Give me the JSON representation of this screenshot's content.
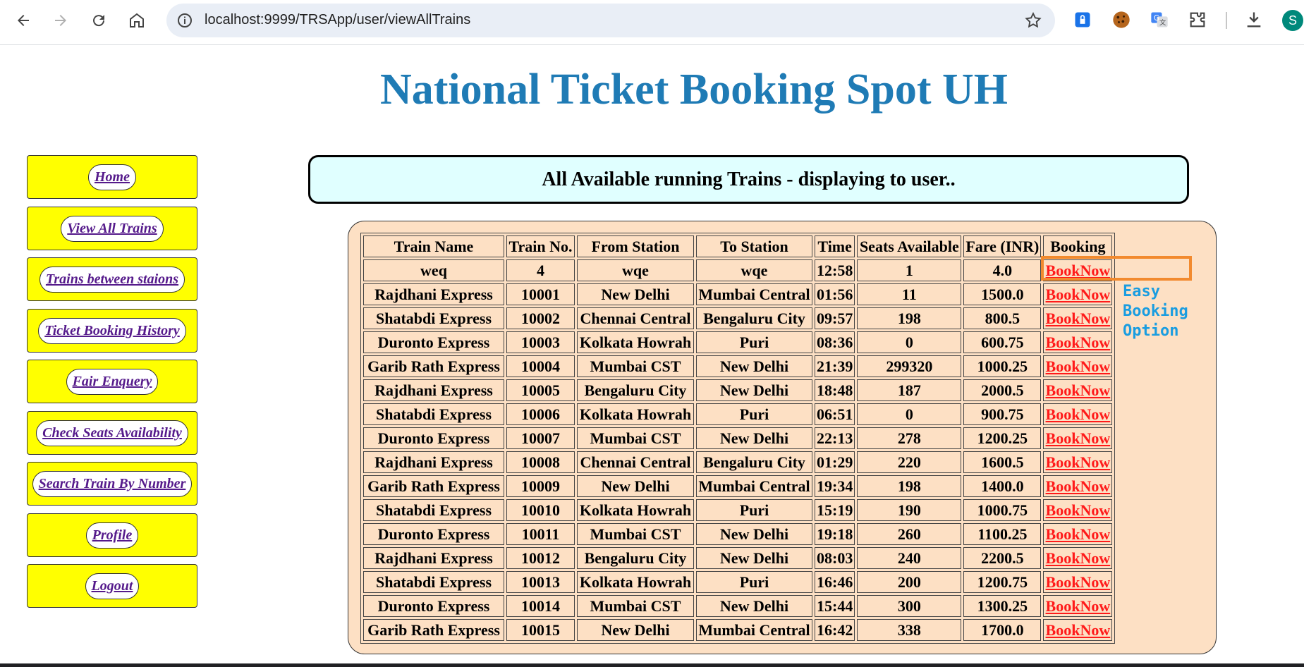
{
  "browser": {
    "url": "localhost:9999/TRSApp/user/viewAllTrains",
    "profile_initial": "S",
    "icons": [
      "back-arrow-icon",
      "forward-arrow-icon",
      "reload-icon",
      "home-icon",
      "site-info-icon",
      "bookmark-star-icon",
      "password-manager-icon",
      "cookie-icon",
      "translate-icon",
      "extensions-puzzle-icon",
      "download-icon"
    ]
  },
  "page": {
    "title": "National Ticket Booking Spot UH",
    "banner": "All Available running Trains - displaying to user.."
  },
  "sidebar": {
    "items": [
      {
        "label": "Home"
      },
      {
        "label": "View All Trains"
      },
      {
        "label": "Trains between staions"
      },
      {
        "label": "Ticket Booking History"
      },
      {
        "label": "Fair Enquery"
      },
      {
        "label": "Check Seats Availability"
      },
      {
        "label": "Search Train By Number"
      },
      {
        "label": "Profile"
      },
      {
        "label": "Logout"
      }
    ]
  },
  "table": {
    "headers": [
      "Train Name",
      "Train No.",
      "From Station",
      "To Station",
      "Time",
      "Seats Available",
      "Fare (INR)",
      "Booking"
    ],
    "rows": [
      {
        "name": "weq",
        "number": "4",
        "from": "wqe",
        "to": "wqe",
        "time": "12:58",
        "seats": "1",
        "fare": "4.0",
        "booking": "BookNow"
      },
      {
        "name": "Rajdhani Express",
        "number": "10001",
        "from": "New Delhi",
        "to": "Mumbai Central",
        "time": "01:56",
        "seats": "11",
        "fare": "1500.0",
        "booking": "BookNow"
      },
      {
        "name": "Shatabdi Express",
        "number": "10002",
        "from": "Chennai Central",
        "to": "Bengaluru City",
        "time": "09:57",
        "seats": "198",
        "fare": "800.5",
        "booking": "BookNow"
      },
      {
        "name": "Duronto Express",
        "number": "10003",
        "from": "Kolkata Howrah",
        "to": "Puri",
        "time": "08:36",
        "seats": "0",
        "fare": "600.75",
        "booking": "BookNow"
      },
      {
        "name": "Garib Rath Express",
        "number": "10004",
        "from": "Mumbai CST",
        "to": "New Delhi",
        "time": "21:39",
        "seats": "299320",
        "fare": "1000.25",
        "booking": "BookNow"
      },
      {
        "name": "Rajdhani Express",
        "number": "10005",
        "from": "Bengaluru City",
        "to": "New Delhi",
        "time": "18:48",
        "seats": "187",
        "fare": "2000.5",
        "booking": "BookNow"
      },
      {
        "name": "Shatabdi Express",
        "number": "10006",
        "from": "Kolkata Howrah",
        "to": "Puri",
        "time": "06:51",
        "seats": "0",
        "fare": "900.75",
        "booking": "BookNow"
      },
      {
        "name": "Duronto Express",
        "number": "10007",
        "from": "Mumbai CST",
        "to": "New Delhi",
        "time": "22:13",
        "seats": "278",
        "fare": "1200.25",
        "booking": "BookNow"
      },
      {
        "name": "Rajdhani Express",
        "number": "10008",
        "from": "Chennai Central",
        "to": "Bengaluru City",
        "time": "01:29",
        "seats": "220",
        "fare": "1600.5",
        "booking": "BookNow"
      },
      {
        "name": "Garib Rath Express",
        "number": "10009",
        "from": "New Delhi",
        "to": "Mumbai Central",
        "time": "19:34",
        "seats": "198",
        "fare": "1400.0",
        "booking": "BookNow"
      },
      {
        "name": "Shatabdi Express",
        "number": "10010",
        "from": "Kolkata Howrah",
        "to": "Puri",
        "time": "15:19",
        "seats": "190",
        "fare": "1000.75",
        "booking": "BookNow"
      },
      {
        "name": "Duronto Express",
        "number": "10011",
        "from": "Mumbai CST",
        "to": "New Delhi",
        "time": "19:18",
        "seats": "260",
        "fare": "1100.25",
        "booking": "BookNow"
      },
      {
        "name": "Rajdhani Express",
        "number": "10012",
        "from": "Bengaluru City",
        "to": "New Delhi",
        "time": "08:03",
        "seats": "240",
        "fare": "2200.5",
        "booking": "BookNow"
      },
      {
        "name": "Shatabdi Express",
        "number": "10013",
        "from": "Kolkata Howrah",
        "to": "Puri",
        "time": "16:46",
        "seats": "200",
        "fare": "1200.75",
        "booking": "BookNow"
      },
      {
        "name": "Duronto Express",
        "number": "10014",
        "from": "Mumbai CST",
        "to": "New Delhi",
        "time": "15:44",
        "seats": "300",
        "fare": "1300.25",
        "booking": "BookNow"
      },
      {
        "name": "Garib Rath Express",
        "number": "10015",
        "from": "New Delhi",
        "to": "Mumbai Central",
        "time": "16:42",
        "seats": "338",
        "fare": "1700.0",
        "booking": "BookNow"
      }
    ]
  },
  "annotation": {
    "text": "Easy Booking Option",
    "color": "#1a9de0",
    "box_color": "#f28a2e"
  }
}
